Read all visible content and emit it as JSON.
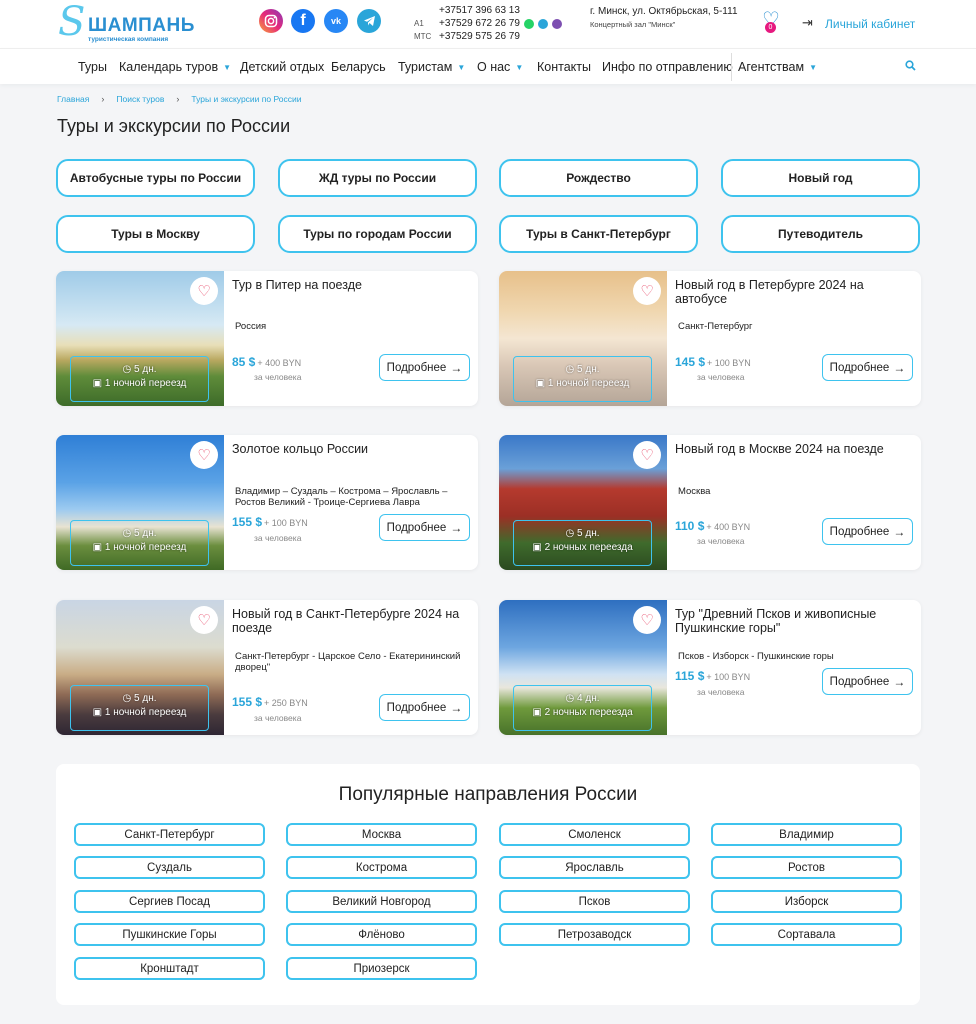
{
  "header": {
    "logo_letter": "S",
    "logo_name": "ШАМПАНЬ",
    "logo_sub": "туристическая компания",
    "social": [
      "instagram-icon",
      "facebook-icon",
      "vk-icon",
      "telegram-icon"
    ],
    "phones": [
      {
        "operator": "",
        "number": "+37517 396 63 13"
      },
      {
        "operator": "A1",
        "number": "+37529 672 26 79"
      },
      {
        "operator": "МТС",
        "number": "+37529 575 26 79"
      }
    ],
    "address_line1": "г. Минск, ул. Октябрьская, 5-111",
    "address_line2": "Концертный зал \"Минск\"",
    "favorites_count": "0",
    "login_label": "Личный кабинет"
  },
  "nav": {
    "items": [
      "Туры",
      "Календарь туров",
      "Детский отдых",
      "Беларусь",
      "Туристам",
      "О нас",
      "Контакты",
      "Инфо по отправлению",
      "Агентствам"
    ]
  },
  "breadcrumb": [
    "Главная",
    "Поиск туров",
    "Туры и экскурсии по России"
  ],
  "page_title": "Туры и экскурсии по России",
  "categories": [
    "Автобусные туры по России",
    "ЖД туры по России",
    "Рождество",
    "Новый год",
    "Туры в Москву",
    "Туры по городам России",
    "Туры в Санкт-Петербург",
    "Путеводитель"
  ],
  "tours": [
    {
      "title": "Тур в Питер на поезде",
      "route": "Россия",
      "price": "85 $",
      "extra": "+ 400 BYN",
      "per": "за человека",
      "days": "5 дн.",
      "transfer": "1 ночной переезд",
      "more": "Подробнее"
    },
    {
      "title": "Новый год в Петербурге 2024 на автобусе",
      "route": "Санкт-Петербург",
      "price": "145 $",
      "extra": "+ 100 BYN",
      "per": "за человека",
      "days": "5 дн.",
      "transfer": "1 ночной переезд",
      "more": "Подробнее"
    },
    {
      "title": "Золотое кольцо России",
      "route": "Владимир – Суздаль – Кострома – Ярославль – Ростов Великий - Троице-Сергиева Лавра",
      "price": "155 $",
      "extra": "+ 100 BYN",
      "per": "за человека",
      "days": "5 дн.",
      "transfer": "1 ночной переезд",
      "more": "Подробнее"
    },
    {
      "title": "Новый год в Москве 2024 на поезде",
      "route": "Москва",
      "price": "110 $",
      "extra": "+ 400 BYN",
      "per": "за человека",
      "days": "5 дн.",
      "transfer": "2 ночных переезда",
      "more": "Подробнее"
    },
    {
      "title": "Новый год в Санкт-Петербурге 2024 на поезде",
      "route": "Санкт-Петербург - Царское Село - Екатерининский дворец\"",
      "price": "155 $",
      "extra": "+ 250 BYN",
      "per": "за человека",
      "days": "5 дн.",
      "transfer": "1 ночной переезд",
      "more": "Подробнее"
    },
    {
      "title": "Тур \"Древний Псков и живописные Пушкинские горы\"",
      "route": "Псков - Изборск - Пушкинские горы",
      "price": "115 $",
      "extra": "+ 100 BYN",
      "per": "за человека",
      "days": "4 дн.",
      "transfer": "2 ночных переезда",
      "more": "Подробнее"
    }
  ],
  "popular": {
    "title": "Популярные направления России",
    "items": [
      "Санкт-Петербург",
      "Москва",
      "Смоленск",
      "Владимир",
      "Суздаль",
      "Кострома",
      "Ярославль",
      "Ростов",
      "Сергиев Посад",
      "Великий Новгород",
      "Псков",
      "Изборск",
      "Пушкинские Горы",
      "Флёново",
      "Петрозаводск",
      "Сортавала",
      "Кронштадт",
      "Приозерск"
    ]
  },
  "colors": {
    "accent": "#3ec3ee",
    "link": "#2aa5d9",
    "price": "#2aa5d9",
    "heart": "#e8506e"
  }
}
